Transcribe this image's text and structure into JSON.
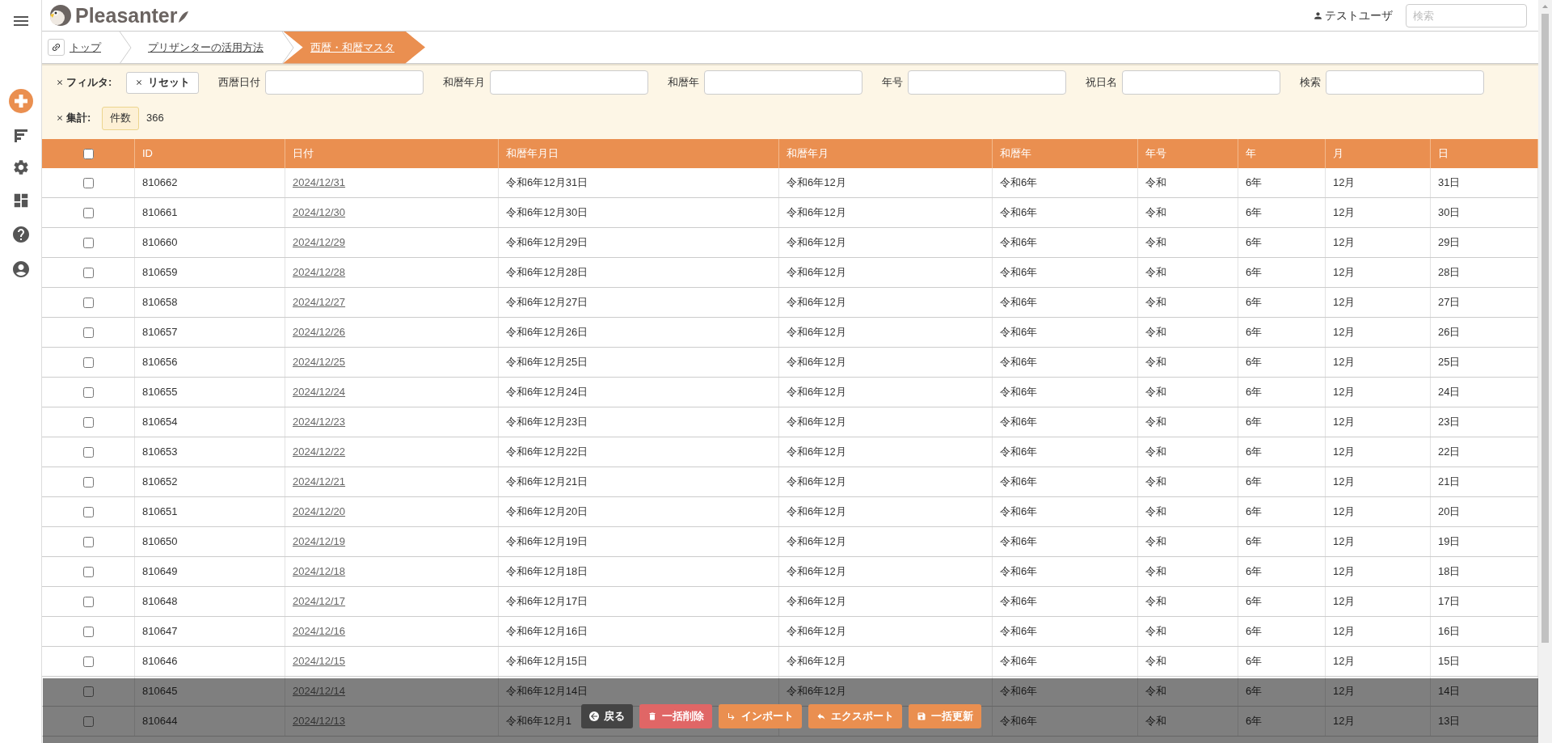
{
  "header": {
    "logo": "Pleasanter",
    "user": "テストユーザ",
    "search": {
      "placeholder": "検索"
    }
  },
  "breadcrumb": [
    {
      "label": "トップ",
      "selected": false
    },
    {
      "label": "プリザンターの活用方法",
      "selected": false
    },
    {
      "label": "西暦・和暦マスタ",
      "selected": true
    }
  ],
  "filter": {
    "label": "フィルタ:",
    "reset": "リセット",
    "fields": [
      {
        "label": "西暦日付"
      },
      {
        "label": "和暦年月"
      },
      {
        "label": "和暦年"
      },
      {
        "label": "年号"
      },
      {
        "label": "祝日名"
      },
      {
        "label": "検索"
      }
    ]
  },
  "aggregate": {
    "label": "集計:",
    "badge": "件数",
    "value": "366"
  },
  "table": {
    "select_all": {
      "checked": false
    },
    "columns": [
      "ID",
      "日付",
      "和暦年月日",
      "和暦年月",
      "和暦年",
      "年号",
      "年",
      "月",
      "日"
    ],
    "rows": [
      {
        "checked": false,
        "cells": [
          "810662",
          "2024/12/31",
          "令和6年12月31日",
          "令和6年12月",
          "令和6年",
          "令和",
          "6年",
          "12月",
          "31日"
        ]
      },
      {
        "checked": false,
        "cells": [
          "810661",
          "2024/12/30",
          "令和6年12月30日",
          "令和6年12月",
          "令和6年",
          "令和",
          "6年",
          "12月",
          "30日"
        ]
      },
      {
        "checked": false,
        "cells": [
          "810660",
          "2024/12/29",
          "令和6年12月29日",
          "令和6年12月",
          "令和6年",
          "令和",
          "6年",
          "12月",
          "29日"
        ]
      },
      {
        "checked": false,
        "cells": [
          "810659",
          "2024/12/28",
          "令和6年12月28日",
          "令和6年12月",
          "令和6年",
          "令和",
          "6年",
          "12月",
          "28日"
        ]
      },
      {
        "checked": false,
        "cells": [
          "810658",
          "2024/12/27",
          "令和6年12月27日",
          "令和6年12月",
          "令和6年",
          "令和",
          "6年",
          "12月",
          "27日"
        ]
      },
      {
        "checked": false,
        "cells": [
          "810657",
          "2024/12/26",
          "令和6年12月26日",
          "令和6年12月",
          "令和6年",
          "令和",
          "6年",
          "12月",
          "26日"
        ]
      },
      {
        "checked": false,
        "cells": [
          "810656",
          "2024/12/25",
          "令和6年12月25日",
          "令和6年12月",
          "令和6年",
          "令和",
          "6年",
          "12月",
          "25日"
        ]
      },
      {
        "checked": false,
        "cells": [
          "810655",
          "2024/12/24",
          "令和6年12月24日",
          "令和6年12月",
          "令和6年",
          "令和",
          "6年",
          "12月",
          "24日"
        ]
      },
      {
        "checked": false,
        "cells": [
          "810654",
          "2024/12/23",
          "令和6年12月23日",
          "令和6年12月",
          "令和6年",
          "令和",
          "6年",
          "12月",
          "23日"
        ]
      },
      {
        "checked": false,
        "cells": [
          "810653",
          "2024/12/22",
          "令和6年12月22日",
          "令和6年12月",
          "令和6年",
          "令和",
          "6年",
          "12月",
          "22日"
        ]
      },
      {
        "checked": false,
        "cells": [
          "810652",
          "2024/12/21",
          "令和6年12月21日",
          "令和6年12月",
          "令和6年",
          "令和",
          "6年",
          "12月",
          "21日"
        ]
      },
      {
        "checked": false,
        "cells": [
          "810651",
          "2024/12/20",
          "令和6年12月20日",
          "令和6年12月",
          "令和6年",
          "令和",
          "6年",
          "12月",
          "20日"
        ]
      },
      {
        "checked": false,
        "cells": [
          "810650",
          "2024/12/19",
          "令和6年12月19日",
          "令和6年12月",
          "令和6年",
          "令和",
          "6年",
          "12月",
          "19日"
        ]
      },
      {
        "checked": false,
        "cells": [
          "810649",
          "2024/12/18",
          "令和6年12月18日",
          "令和6年12月",
          "令和6年",
          "令和",
          "6年",
          "12月",
          "18日"
        ]
      },
      {
        "checked": false,
        "cells": [
          "810648",
          "2024/12/17",
          "令和6年12月17日",
          "令和6年12月",
          "令和6年",
          "令和",
          "6年",
          "12月",
          "17日"
        ]
      },
      {
        "checked": false,
        "cells": [
          "810647",
          "2024/12/16",
          "令和6年12月16日",
          "令和6年12月",
          "令和6年",
          "令和",
          "6年",
          "12月",
          "16日"
        ]
      },
      {
        "checked": false,
        "cells": [
          "810646",
          "2024/12/15",
          "令和6年12月15日",
          "令和6年12月",
          "令和6年",
          "令和",
          "6年",
          "12月",
          "15日"
        ]
      },
      {
        "checked": false,
        "cells": [
          "810645",
          "2024/12/14",
          "令和6年12月14日",
          "令和6年12月",
          "令和6年",
          "令和",
          "6年",
          "12月",
          "14日"
        ]
      },
      {
        "checked": false,
        "cells": [
          "810644",
          "2024/12/13",
          "令和6年12月1",
          null,
          "令和6年",
          "令和",
          "6年",
          "12月",
          "13日"
        ]
      }
    ]
  },
  "actions": [
    {
      "label": "戻る",
      "kind": "back"
    },
    {
      "label": "一括削除",
      "kind": "delete"
    },
    {
      "label": "インポート",
      "kind": "import"
    },
    {
      "label": "エクスポート",
      "kind": "export"
    },
    {
      "label": "一括更新",
      "kind": "update"
    }
  ]
}
